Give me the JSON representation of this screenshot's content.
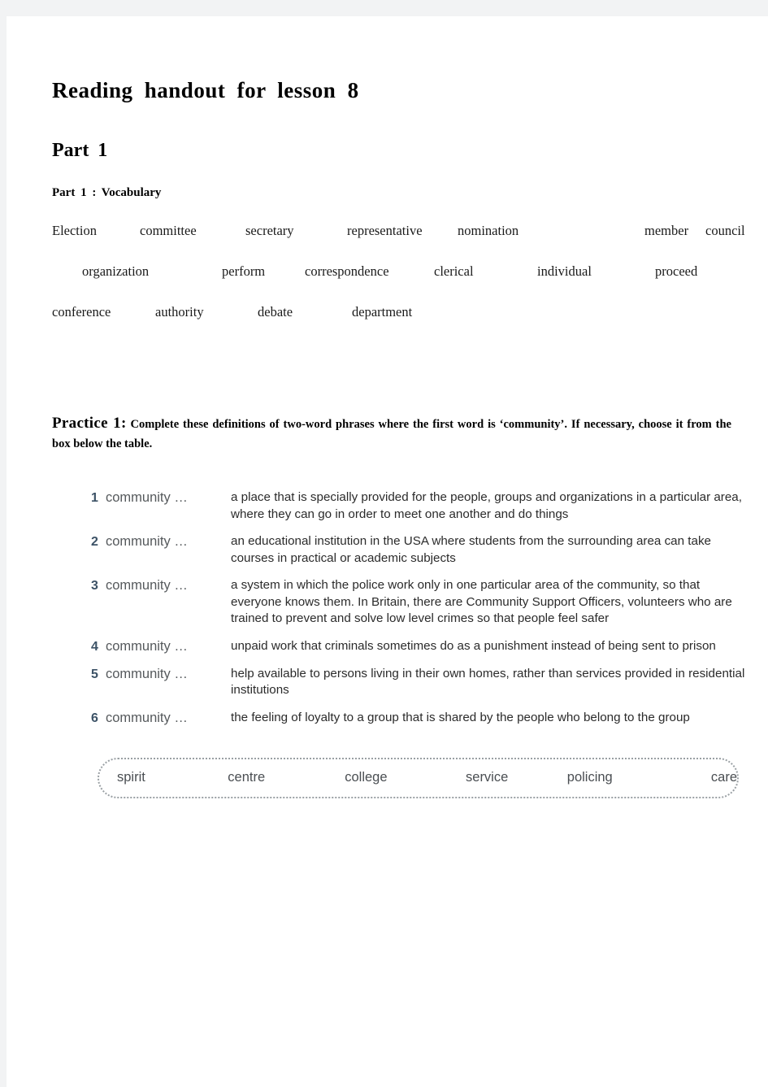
{
  "document": {
    "title": "Reading  handout  for  lesson  8",
    "part_heading": "Part  1",
    "section_heading": "Part  1 :  Vocabulary"
  },
  "vocabulary": {
    "rows": [
      [
        "Election",
        "committee",
        "secretary",
        "representative",
        "nomination",
        "member",
        "council"
      ],
      [
        "",
        "organization",
        "perform",
        "correspondence",
        "clerical",
        "individual",
        "proceed"
      ],
      [
        "conference",
        "authority",
        "debate",
        "department"
      ]
    ]
  },
  "practice": {
    "lead": "Practice  1:",
    "instruction": " Complete  these  definitions  of  two-word  phrases  where  the  first  word  is  ‘community’.  If  necessary,  choose  it  from  the  box  below  the  table."
  },
  "exercise": {
    "items": [
      {
        "number": "1",
        "term": "community …",
        "definition": "a place that is specially provided for the people, groups and organizations in a particular area, where they can go in order to meet one another and do things"
      },
      {
        "number": "2",
        "term": "community …",
        "definition": "an educational institution in the USA where students from the surrounding area can take courses in practical or academic subjects"
      },
      {
        "number": "3",
        "term": "community …",
        "definition": "a system in which the police work only in one particular area of the community, so that everyone knows them. In Britain, there are Community Support Officers, volunteers who are trained to prevent and solve low level crimes so that people feel safer"
      },
      {
        "number": "4",
        "term": "community …",
        "definition": "unpaid work that criminals sometimes do as a punishment instead of being sent to prison"
      },
      {
        "number": "5",
        "term": "community …",
        "definition": "help available to persons living in their own homes, rather than services provided in residential institutions"
      },
      {
        "number": "6",
        "term": "community …",
        "definition": "the feeling of loyalty to a group that is shared by the people who belong to the group"
      }
    ]
  },
  "word_bank": {
    "words": [
      "spirit",
      "centre",
      "college",
      "service",
      "policing",
      "care"
    ]
  },
  "colors": {
    "page_background": "#ffffff",
    "canvas_background": "#f2f3f4",
    "heading_text": "#000000",
    "exercise_number": "#3c5266",
    "exercise_term": "#55595c",
    "exercise_definition": "#2b2b2b",
    "wordbank_border": "#9aa0a4",
    "wordbank_text": "#4a4e52"
  }
}
